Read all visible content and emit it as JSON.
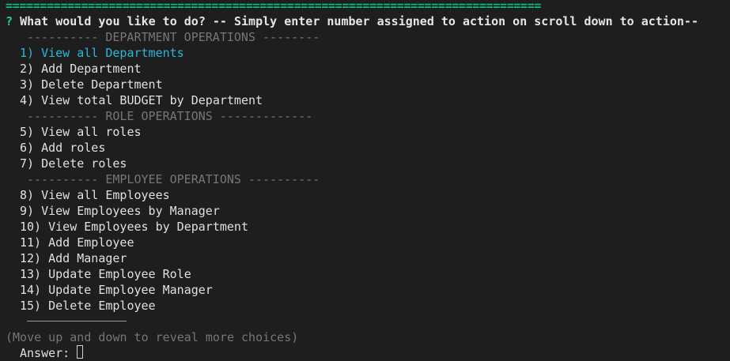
{
  "terminal": {
    "rule": "==============================================================================",
    "prompt_mark": "?",
    "prompt_text": "What would you like to do? -- Simply enter number assigned to action on scroll down to action--",
    "separators": {
      "department": "---------- DEPARTMENT OPERATIONS --------",
      "role": "---------- ROLE OPERATIONS -------------",
      "employee": "---------- EMPLOYEE OPERATIONS ----------"
    },
    "choices": [
      "1) View all Departments",
      "2) Add Department",
      "3) Delete Department",
      "4) View total BUDGET by Department",
      "5) View all roles",
      "6) Add roles",
      "7) Delete roles",
      "8) View all Employees",
      "9) View Employees by Manager",
      "10) View Employees by Department",
      "11) Add Employee",
      "12) Add Manager",
      "13) Update Employee Role",
      "14) Update Employee Manager",
      "15) Delete Employee"
    ],
    "selected_index": 0,
    "hint": "(Move up and down to reveal more choices)",
    "answer_label": "Answer:",
    "colors": {
      "background": "#1e1e1e",
      "rule": "#0dbc79",
      "prompt_mark": "#23d18b",
      "selected": "#29b8db",
      "separator": "#767676"
    }
  }
}
